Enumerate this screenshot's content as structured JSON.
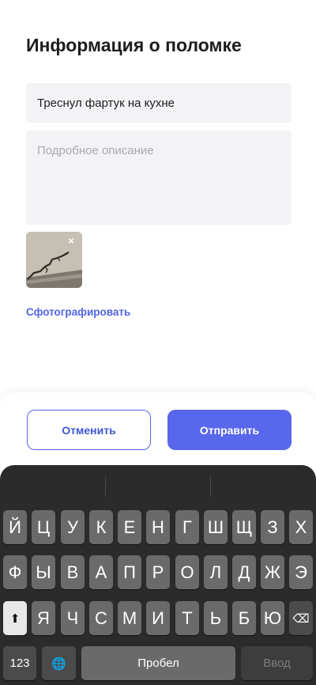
{
  "form": {
    "title": "Информация о поломке",
    "issue_value": "Треснул фартук на кухне",
    "description_placeholder": "Подробное описание",
    "photo_remove_icon": "×",
    "take_photo_label": "Сфотографировать"
  },
  "actions": {
    "cancel_label": "Отменить",
    "submit_label": "Отправить"
  },
  "keyboard": {
    "row1": [
      "Й",
      "Ц",
      "У",
      "К",
      "Е",
      "Н",
      "Г",
      "Ш",
      "Щ",
      "З",
      "Х"
    ],
    "row2": [
      "Ф",
      "Ы",
      "В",
      "А",
      "П",
      "Р",
      "О",
      "Л",
      "Д",
      "Ж",
      "Э"
    ],
    "row3": [
      "Я",
      "Ч",
      "С",
      "М",
      "И",
      "Т",
      "Ь",
      "Б",
      "Ю"
    ],
    "shift_icon": "⬆",
    "backspace_icon": "⌫",
    "numbers_label": "123",
    "globe_icon": "🌐",
    "space_label": "Пробел",
    "enter_label": "Ввод"
  },
  "colors": {
    "accent": "#5165e8",
    "keyboard_bg": "#2b2b2b",
    "key_bg": "#6a6a6a"
  }
}
